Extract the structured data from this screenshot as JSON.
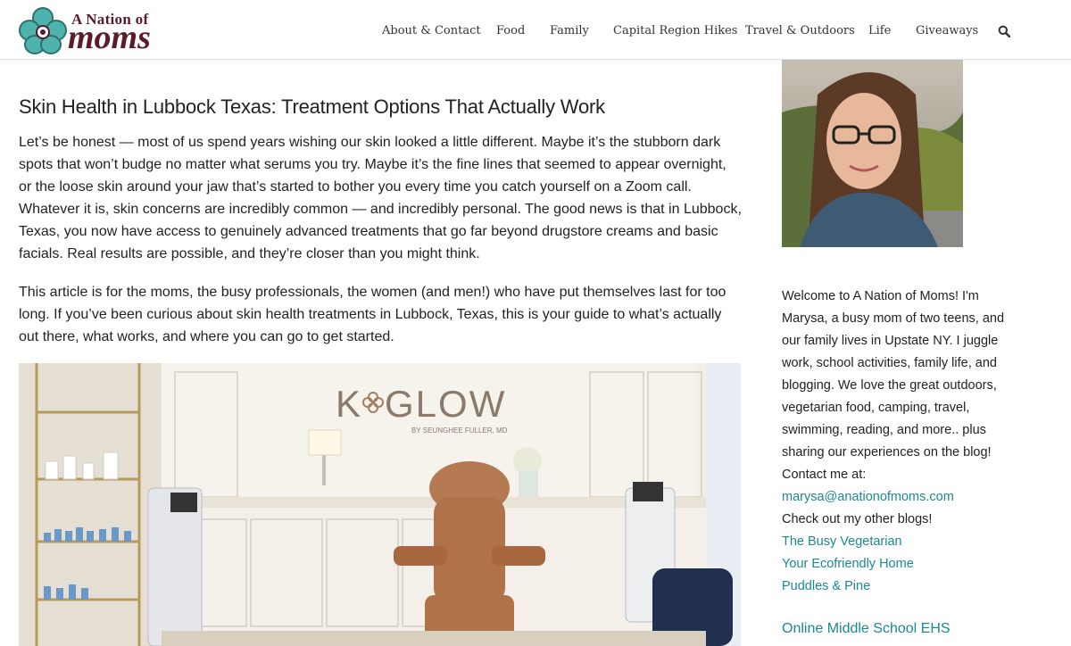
{
  "logo": {
    "top_text": "A Nation of",
    "main_text": "moms"
  },
  "nav": {
    "items": [
      "About & Contact",
      "Food",
      "Family",
      "Capital Region Hikes",
      "Travel & Outdoors",
      "Life",
      "Giveaways"
    ],
    "search_icon": "search-icon"
  },
  "article": {
    "title": "Skin Health in Lubbock Texas: Treatment Options That Actually Work",
    "paragraphs": [
      "Let’s be honest — most of us spend years wishing our skin looked a little different. Maybe it’s the stubborn dark spots that won’t budge no matter what serums you try. Maybe it’s the fine lines that seemed to appear overnight, or the loose skin around your jaw that’s started to bother you every time you catch yourself on a Zoom call. Whatever it is, skin concerns are incredibly common — and incredibly personal. The good news is that in Lubbock, Texas, you now have access to genuinely advanced treatments that go far beyond drugstore creams and basic facials. Real results are possible, and they’re closer than you might think.",
      "This article is for the moms, the busy professionals, the women (and men!) who have put themselves last for too long. If you’ve been curious about skin health treatments in Lubbock, Texas, this is your guide to what’s actually out there, what works, and where you can go to get started."
    ],
    "image": {
      "brand": "K GLOW",
      "brand_sub": "BY SEUNGHEE FULLER, MD"
    }
  },
  "sidebar": {
    "bio_lines": [
      "Welcome to A Nation of Moms! I'm",
      "Marysa, a busy mom of two teens, and",
      "our family lives in Upstate NY. I juggle",
      "work, school activities, family life, and",
      "blogging. We love the great outdoors,",
      "vegetarian food, camping, travel,",
      "swimming, reading, and more.. plus",
      "sharing our experiences on the blog!",
      "Contact me at:"
    ],
    "email": "marysa@anationofmoms.com",
    "other_blogs_label": "Check out my other blogs!",
    "blogs": [
      "The Busy Vegetarian",
      "Your Ecofriendly Home",
      "Puddles & Pine"
    ],
    "next_heading": "Online Middle School EHS"
  },
  "colors": {
    "accent": "#1b8a8e",
    "logo": "#5c1a2a",
    "flower": "#4fb3ad"
  }
}
